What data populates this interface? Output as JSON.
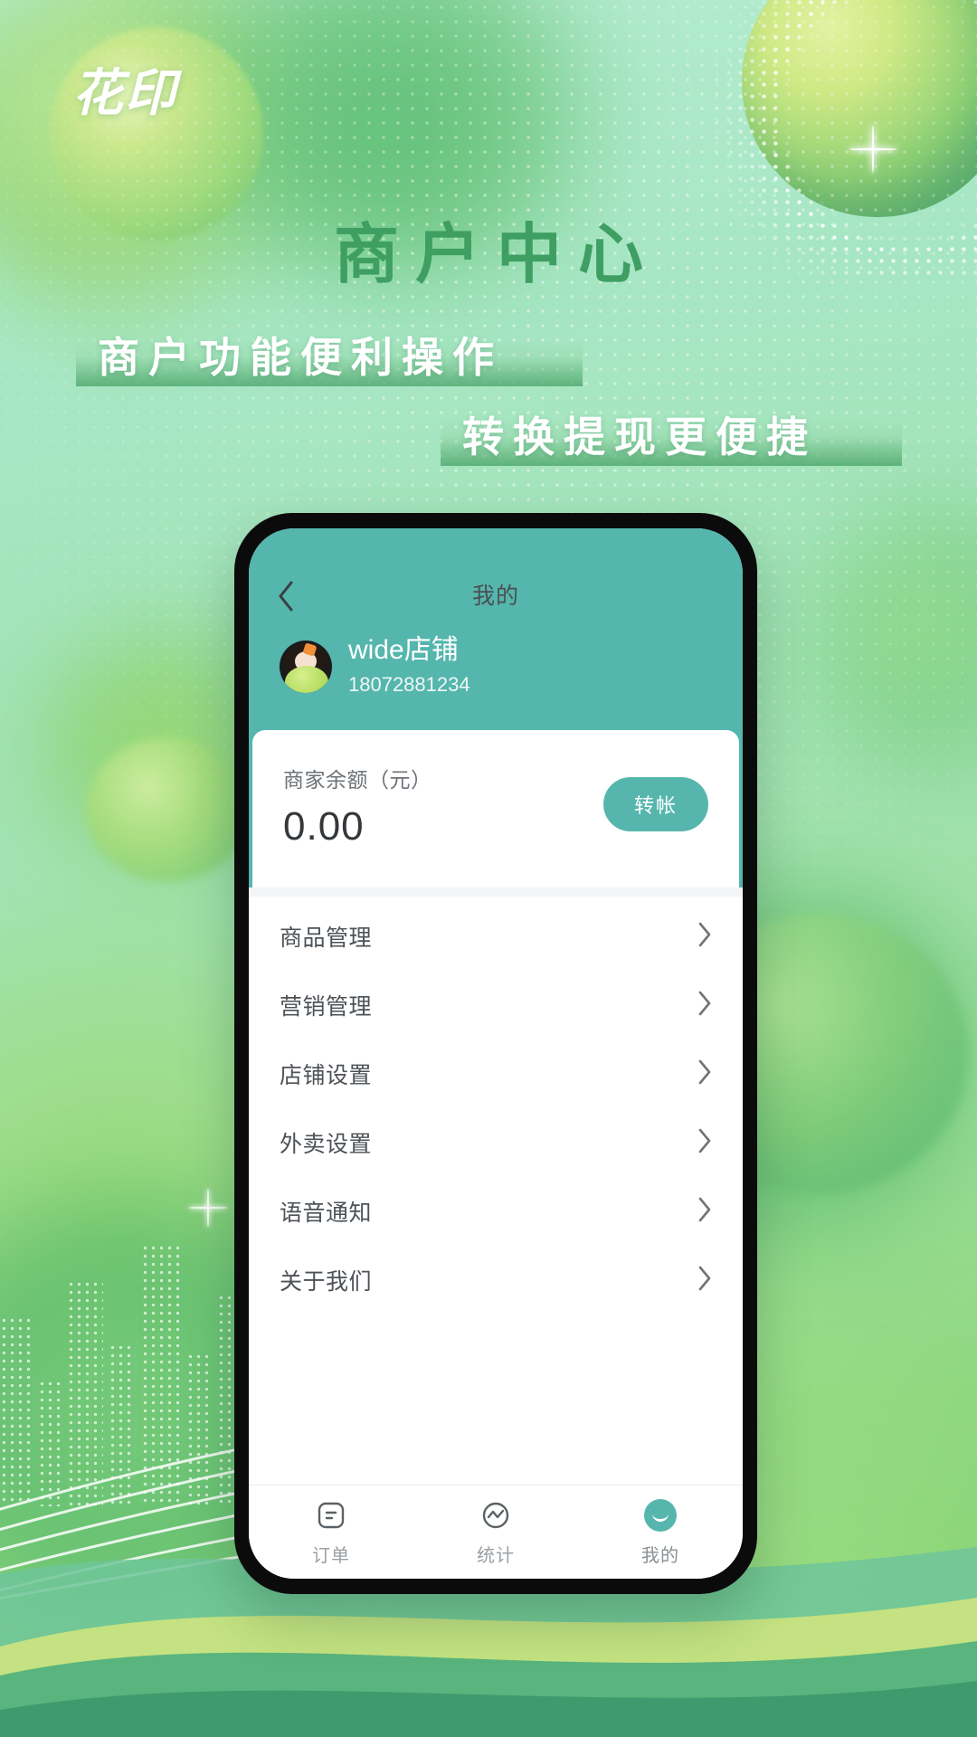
{
  "brand": {
    "logo_text": "花印"
  },
  "poster": {
    "headline": "商户中心",
    "subheadline_1": "商户功能便利操作",
    "subheadline_2": "转换提现更便捷",
    "accent_green": "#3f9f63",
    "bar_green": "#4aa368",
    "app_teal": "#54b6ad"
  },
  "app": {
    "nav": {
      "back_icon": "chevron-left-icon",
      "title": "我的"
    },
    "profile": {
      "shop_name": "wide店铺",
      "phone": "18072881234",
      "avatar_icon": "avatar-photo"
    },
    "balance": {
      "label": "商家余额（元）",
      "value": "0.00",
      "transfer_label": "转帐"
    },
    "menu": [
      {
        "label": "商品管理",
        "chevron": "chevron-right-icon"
      },
      {
        "label": "营销管理",
        "chevron": "chevron-right-icon"
      },
      {
        "label": "店铺设置",
        "chevron": "chevron-right-icon"
      },
      {
        "label": "外卖设置",
        "chevron": "chevron-right-icon"
      },
      {
        "label": "语音通知",
        "chevron": "chevron-right-icon"
      },
      {
        "label": "关于我们",
        "chevron": "chevron-right-icon"
      }
    ],
    "tabs": [
      {
        "label": "订单",
        "icon": "order-receipt-icon",
        "active": false
      },
      {
        "label": "统计",
        "icon": "stats-chart-icon",
        "active": false
      },
      {
        "label": "我的",
        "icon": "profile-smile-icon",
        "active": true
      }
    ]
  }
}
